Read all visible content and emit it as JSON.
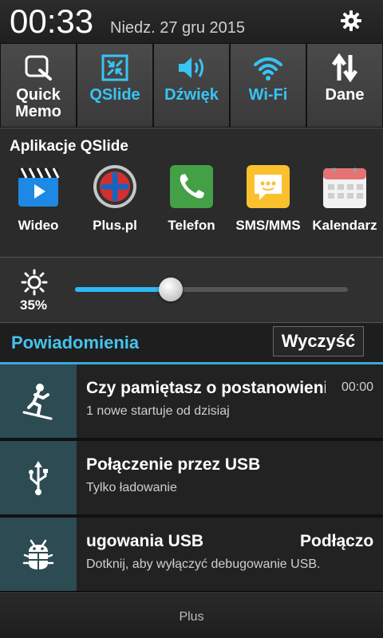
{
  "status": {
    "time": "00:33",
    "date": "Niedz. 27 gru 2015",
    "settings_icon": "gear-icon"
  },
  "toggles": [
    {
      "label_line1": "Quick",
      "label_line2": "Memo",
      "icon": "quick-memo-icon",
      "active": false
    },
    {
      "label_line1": "QSlide",
      "label_line2": "",
      "icon": "qslide-icon",
      "active": true
    },
    {
      "label_line1": "Dźwięk",
      "label_line2": "",
      "icon": "volume-icon",
      "active": true
    },
    {
      "label_line1": "Wi-Fi",
      "label_line2": "",
      "icon": "wifi-icon",
      "active": true
    },
    {
      "label_line1": "Dane",
      "label_line2": "",
      "icon": "data-arrows-icon",
      "active": false
    }
  ],
  "qslide": {
    "title": "Aplikacje QSlide",
    "apps": [
      {
        "label": "Wideo",
        "icon": "video-app-icon"
      },
      {
        "label": "Plus.pl",
        "icon": "plus-app-icon"
      },
      {
        "label": "Telefon",
        "icon": "phone-app-icon"
      },
      {
        "label": "SMS/MMS",
        "icon": "sms-app-icon"
      },
      {
        "label": "Kalendarz",
        "icon": "calendar-app-icon"
      }
    ]
  },
  "brightness": {
    "value_label": "35%",
    "level": 0.35,
    "icon": "sun-icon"
  },
  "notifications": {
    "title": "Powiadomienia",
    "clear_label": "Wyczyść",
    "items": [
      {
        "title": "Czy pamiętasz o postanowieniu",
        "subtitle": "1 nowe startuje od dzisiaj",
        "time": "00:00",
        "icon": "skier-icon"
      },
      {
        "title": "Połączenie przez USB",
        "subtitle": "Tylko ładowanie",
        "time": "",
        "icon": "usb-icon"
      },
      {
        "title": "ugowania USB",
        "title_right": "Podłączo",
        "subtitle": "Dotknij, aby wyłączyć debugowanie USB.",
        "time": "",
        "icon": "android-debug-icon"
      }
    ]
  },
  "footer": {
    "carrier": "Plus"
  },
  "colors": {
    "accent": "#38c4f5",
    "notif_title": "#46c2ec",
    "notif_icon_bg": "#2d4b52"
  }
}
